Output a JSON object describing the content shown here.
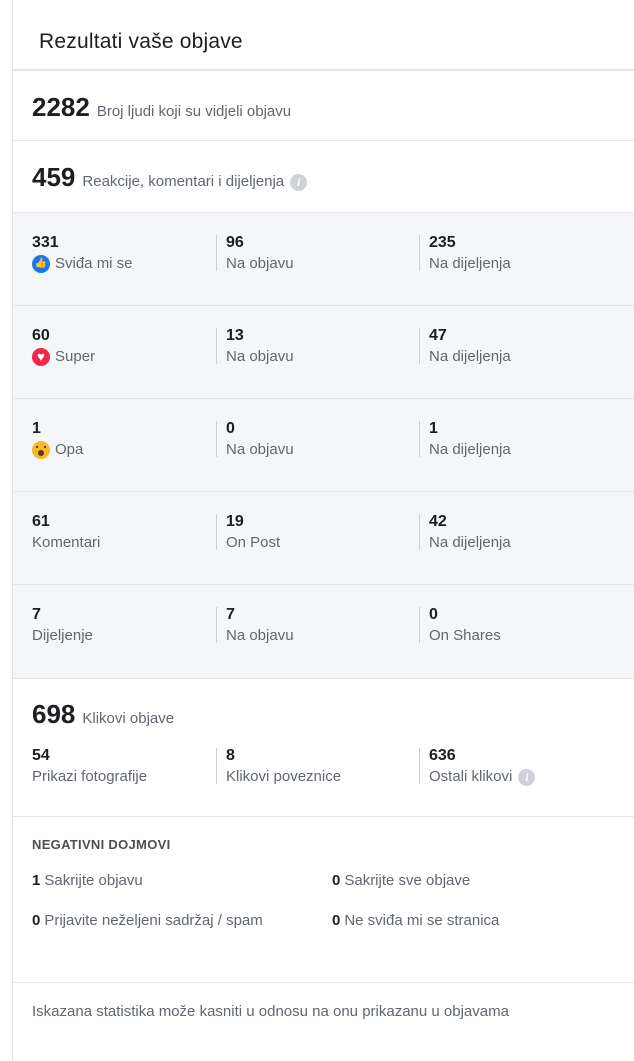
{
  "header": {
    "title": "Rezultati vaše objave"
  },
  "reach": {
    "value": "2282",
    "label": "Broj ljudi koji su vidjeli objavu"
  },
  "engagement": {
    "value": "459",
    "label": "Reakcije, komentari i dijeljenja"
  },
  "reaction_rows": [
    {
      "total": "331",
      "label": "Sviđa mi se",
      "icon": "like-icon",
      "on_post": "96",
      "on_post_label": "Na objavu",
      "on_shares": "235",
      "on_shares_label": "Na dijeljenja"
    },
    {
      "total": "60",
      "label": "Super",
      "icon": "love-icon",
      "on_post": "13",
      "on_post_label": "Na objavu",
      "on_shares": "47",
      "on_shares_label": "Na dijeljenja"
    },
    {
      "total": "1",
      "label": "Opa",
      "icon": "wow-icon",
      "on_post": "0",
      "on_post_label": "Na objavu",
      "on_shares": "1",
      "on_shares_label": "Na dijeljenja"
    },
    {
      "total": "61",
      "label": "Komentari",
      "on_post": "19",
      "on_post_label": "On Post",
      "on_shares": "42",
      "on_shares_label": "Na dijeljenja"
    },
    {
      "total": "7",
      "label": "Dijeljenje",
      "on_post": "7",
      "on_post_label": "Na objavu",
      "on_shares": "0",
      "on_shares_label": "On Shares"
    }
  ],
  "clicks": {
    "value": "698",
    "label": "Klikovi objave",
    "photo_views": "54",
    "photo_views_label": "Prikazi fotografije",
    "link_clicks": "8",
    "link_clicks_label": "Klikovi poveznice",
    "other_clicks": "636",
    "other_clicks_label": "Ostali klikovi"
  },
  "negative": {
    "title": "NEGATIVNI DOJMOVI",
    "items": [
      {
        "value": "1",
        "label": "Sakrijte objavu"
      },
      {
        "value": "0",
        "label": "Sakrijte sve objave"
      },
      {
        "value": "0",
        "label": "Prijavite neželjeni sadržaj / spam"
      },
      {
        "value": "0",
        "label": "Ne sviđa mi se stranica"
      }
    ]
  },
  "footer": {
    "note": "Iskazana statistika može kasniti u odnosu na onu prikazanu u objavama"
  },
  "colors": {
    "like": "#1877f2",
    "love": "#f0284a",
    "wow": "#f7b928",
    "muted_text": "#606770"
  }
}
